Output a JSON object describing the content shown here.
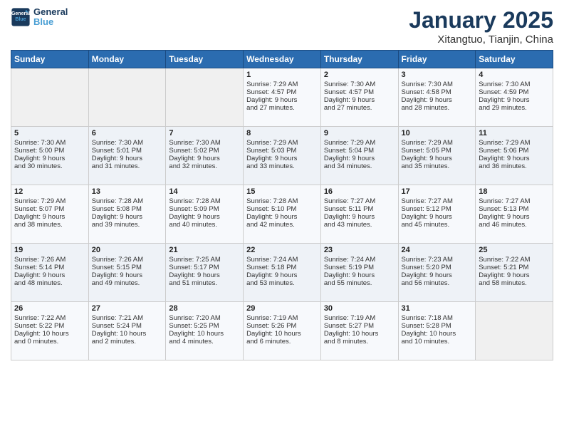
{
  "logo": {
    "line1": "General",
    "line2": "Blue"
  },
  "title": "January 2025",
  "subtitle": "Xitangtuo, Tianjin, China",
  "weekdays": [
    "Sunday",
    "Monday",
    "Tuesday",
    "Wednesday",
    "Thursday",
    "Friday",
    "Saturday"
  ],
  "weeks": [
    [
      {
        "day": "",
        "content": ""
      },
      {
        "day": "",
        "content": ""
      },
      {
        "day": "",
        "content": ""
      },
      {
        "day": "1",
        "content": "Sunrise: 7:29 AM\nSunset: 4:57 PM\nDaylight: 9 hours\nand 27 minutes."
      },
      {
        "day": "2",
        "content": "Sunrise: 7:30 AM\nSunset: 4:57 PM\nDaylight: 9 hours\nand 27 minutes."
      },
      {
        "day": "3",
        "content": "Sunrise: 7:30 AM\nSunset: 4:58 PM\nDaylight: 9 hours\nand 28 minutes."
      },
      {
        "day": "4",
        "content": "Sunrise: 7:30 AM\nSunset: 4:59 PM\nDaylight: 9 hours\nand 29 minutes."
      }
    ],
    [
      {
        "day": "5",
        "content": "Sunrise: 7:30 AM\nSunset: 5:00 PM\nDaylight: 9 hours\nand 30 minutes."
      },
      {
        "day": "6",
        "content": "Sunrise: 7:30 AM\nSunset: 5:01 PM\nDaylight: 9 hours\nand 31 minutes."
      },
      {
        "day": "7",
        "content": "Sunrise: 7:30 AM\nSunset: 5:02 PM\nDaylight: 9 hours\nand 32 minutes."
      },
      {
        "day": "8",
        "content": "Sunrise: 7:29 AM\nSunset: 5:03 PM\nDaylight: 9 hours\nand 33 minutes."
      },
      {
        "day": "9",
        "content": "Sunrise: 7:29 AM\nSunset: 5:04 PM\nDaylight: 9 hours\nand 34 minutes."
      },
      {
        "day": "10",
        "content": "Sunrise: 7:29 AM\nSunset: 5:05 PM\nDaylight: 9 hours\nand 35 minutes."
      },
      {
        "day": "11",
        "content": "Sunrise: 7:29 AM\nSunset: 5:06 PM\nDaylight: 9 hours\nand 36 minutes."
      }
    ],
    [
      {
        "day": "12",
        "content": "Sunrise: 7:29 AM\nSunset: 5:07 PM\nDaylight: 9 hours\nand 38 minutes."
      },
      {
        "day": "13",
        "content": "Sunrise: 7:28 AM\nSunset: 5:08 PM\nDaylight: 9 hours\nand 39 minutes."
      },
      {
        "day": "14",
        "content": "Sunrise: 7:28 AM\nSunset: 5:09 PM\nDaylight: 9 hours\nand 40 minutes."
      },
      {
        "day": "15",
        "content": "Sunrise: 7:28 AM\nSunset: 5:10 PM\nDaylight: 9 hours\nand 42 minutes."
      },
      {
        "day": "16",
        "content": "Sunrise: 7:27 AM\nSunset: 5:11 PM\nDaylight: 9 hours\nand 43 minutes."
      },
      {
        "day": "17",
        "content": "Sunrise: 7:27 AM\nSunset: 5:12 PM\nDaylight: 9 hours\nand 45 minutes."
      },
      {
        "day": "18",
        "content": "Sunrise: 7:27 AM\nSunset: 5:13 PM\nDaylight: 9 hours\nand 46 minutes."
      }
    ],
    [
      {
        "day": "19",
        "content": "Sunrise: 7:26 AM\nSunset: 5:14 PM\nDaylight: 9 hours\nand 48 minutes."
      },
      {
        "day": "20",
        "content": "Sunrise: 7:26 AM\nSunset: 5:15 PM\nDaylight: 9 hours\nand 49 minutes."
      },
      {
        "day": "21",
        "content": "Sunrise: 7:25 AM\nSunset: 5:17 PM\nDaylight: 9 hours\nand 51 minutes."
      },
      {
        "day": "22",
        "content": "Sunrise: 7:24 AM\nSunset: 5:18 PM\nDaylight: 9 hours\nand 53 minutes."
      },
      {
        "day": "23",
        "content": "Sunrise: 7:24 AM\nSunset: 5:19 PM\nDaylight: 9 hours\nand 55 minutes."
      },
      {
        "day": "24",
        "content": "Sunrise: 7:23 AM\nSunset: 5:20 PM\nDaylight: 9 hours\nand 56 minutes."
      },
      {
        "day": "25",
        "content": "Sunrise: 7:22 AM\nSunset: 5:21 PM\nDaylight: 9 hours\nand 58 minutes."
      }
    ],
    [
      {
        "day": "26",
        "content": "Sunrise: 7:22 AM\nSunset: 5:22 PM\nDaylight: 10 hours\nand 0 minutes."
      },
      {
        "day": "27",
        "content": "Sunrise: 7:21 AM\nSunset: 5:24 PM\nDaylight: 10 hours\nand 2 minutes."
      },
      {
        "day": "28",
        "content": "Sunrise: 7:20 AM\nSunset: 5:25 PM\nDaylight: 10 hours\nand 4 minutes."
      },
      {
        "day": "29",
        "content": "Sunrise: 7:19 AM\nSunset: 5:26 PM\nDaylight: 10 hours\nand 6 minutes."
      },
      {
        "day": "30",
        "content": "Sunrise: 7:19 AM\nSunset: 5:27 PM\nDaylight: 10 hours\nand 8 minutes."
      },
      {
        "day": "31",
        "content": "Sunrise: 7:18 AM\nSunset: 5:28 PM\nDaylight: 10 hours\nand 10 minutes."
      },
      {
        "day": "",
        "content": ""
      }
    ]
  ]
}
